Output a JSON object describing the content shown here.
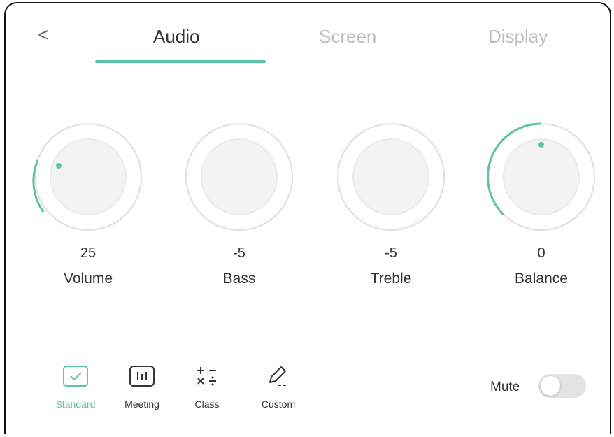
{
  "nav": {
    "back_glyph": "<",
    "tabs": [
      {
        "label": "Audio",
        "active": true
      },
      {
        "label": "Screen",
        "active": false
      },
      {
        "label": "Display",
        "active": false
      }
    ]
  },
  "knobs": [
    {
      "label": "Volume",
      "value": "25"
    },
    {
      "label": "Bass",
      "value": "-5"
    },
    {
      "label": "Treble",
      "value": "-5"
    },
    {
      "label": "Balance",
      "value": "0"
    }
  ],
  "modes": [
    {
      "label": "Standard",
      "icon": "checkbox-icon",
      "active": true
    },
    {
      "label": "Meeting",
      "icon": "equalizer-icon",
      "active": false
    },
    {
      "label": "Class",
      "icon": "calculator-icon",
      "active": false
    },
    {
      "label": "Custom",
      "icon": "pen-icon",
      "active": false
    }
  ],
  "mute": {
    "label": "Mute",
    "on": false
  },
  "colors": {
    "accent": "#5cc3a6",
    "text": "#333333",
    "inactive_tab": "#bdbdbd"
  }
}
